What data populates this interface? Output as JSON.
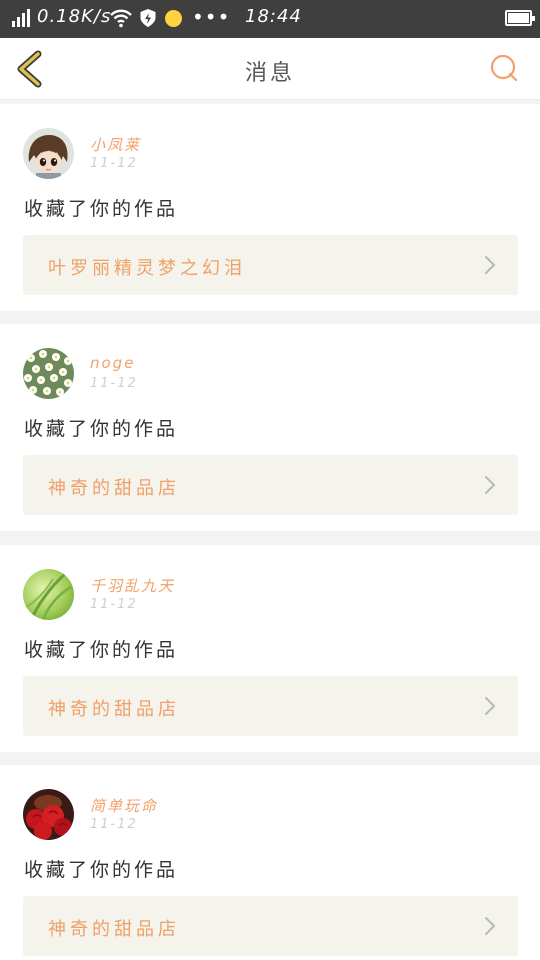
{
  "status_bar": {
    "network_speed": "0.18K/s",
    "dots": "•••",
    "time": "18:44"
  },
  "header": {
    "back_icon": "chevron-left-icon",
    "title": "消息",
    "search_icon": "search-icon"
  },
  "messages": [
    {
      "username": "小凤莱",
      "date": "11-12",
      "action": "收藏了你的作品",
      "work_title": "叶罗丽精灵梦之幻泪",
      "avatar": "avatar-cartoon-boy"
    },
    {
      "username": "noge",
      "date": "11-12",
      "action": "收藏了你的作品",
      "work_title": "神奇的甜品店",
      "avatar": "avatar-daisies"
    },
    {
      "username": "千羽乱九天",
      "date": "11-12",
      "action": "收藏了你的作品",
      "work_title": "神奇的甜品店",
      "avatar": "avatar-green-grass"
    },
    {
      "username": "简单玩命",
      "date": "11-12",
      "action": "收藏了你的作品",
      "work_title": "神奇的甜品店",
      "avatar": "avatar-red-flowers"
    }
  ],
  "colors": {
    "status_bar": "#3f3f3f",
    "accent_orange": "#f2a06b",
    "back_arrow": "#d8b33a",
    "work_box_bg": "#f4f3ec",
    "page_bg": "#f3f3f3"
  }
}
